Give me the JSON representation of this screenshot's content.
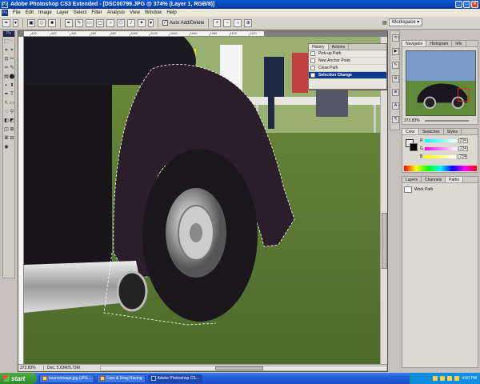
{
  "window": {
    "title": "Adobe Photoshop CS3 Extended - [DSC00799.JPG @ 374% (Layer 1, RGB/8)]",
    "min": "_",
    "max": "□",
    "close": "×"
  },
  "menu": [
    "File",
    "Edit",
    "Image",
    "Layer",
    "Select",
    "Filter",
    "Analysis",
    "View",
    "Window",
    "Help"
  ],
  "options": {
    "auto_add_delete": "Auto Add/Delete",
    "auto_add_checked": "✓",
    "workspace": "Workspace ▾"
  },
  "ruler_ticks": [
    "400",
    "420",
    "440",
    "460",
    "480",
    "1000",
    "1020",
    "1040",
    "1060",
    "1080",
    "1100",
    "1120",
    "1140",
    "1160",
    "1180",
    "1200",
    "1220",
    "1240"
  ],
  "history": {
    "tabs": [
      "History",
      "Actions"
    ],
    "items": [
      {
        "label": "Pick-up Path",
        "selected": false
      },
      {
        "label": "New Anchor Point",
        "selected": false
      },
      {
        "label": "Close Path",
        "selected": false
      },
      {
        "label": "Selection Change",
        "selected": true
      }
    ]
  },
  "navigator": {
    "tabs": [
      "Navigator",
      "Histogram",
      "Info"
    ],
    "zoom": "373.83%"
  },
  "color": {
    "tabs": [
      "Color",
      "Swatches",
      "Styles"
    ],
    "channels": [
      {
        "label": "R",
        "value": "234",
        "gradient": "linear-gradient(90deg,#0ff,#fff)"
      },
      {
        "label": "G",
        "value": "234",
        "gradient": "linear-gradient(90deg,#f0f,#fff)"
      },
      {
        "label": "B",
        "value": "234",
        "gradient": "linear-gradient(90deg,#ff0,#fff)"
      }
    ]
  },
  "paths": {
    "tabs": [
      "Layers",
      "Channels",
      "Paths"
    ],
    "item": "Work Path"
  },
  "status": {
    "zoom": "373.83%",
    "doc": "Doc: 5.63M/5.73M"
  },
  "taskbar": {
    "start": "start",
    "buttons": [
      {
        "label": "sourceimage.jpg (JPE...",
        "active": false
      },
      {
        "label": "Cars & Drag Racing",
        "active": false
      },
      {
        "label": "Adobe Photoshop CS...",
        "active": true
      }
    ],
    "clock": "4:00 PM"
  }
}
